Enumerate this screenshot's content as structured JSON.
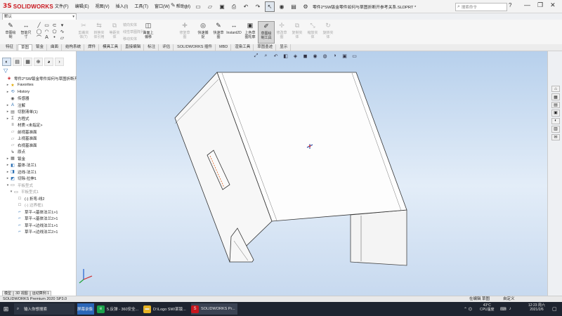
{
  "window": {
    "title": "零件2*SW钣金零件如何与草图折断开参考关系.SLDPRT *",
    "controls": [
      "—",
      "❐",
      "✕"
    ]
  },
  "app": {
    "brand_prefix": "3S",
    "brand": "SOLIDWORKS"
  },
  "menu": [
    "文件(F)",
    "编辑(E)",
    "视图(V)",
    "插入(I)",
    "工具(T)",
    "窗口(W)",
    "帮助(H)"
  ],
  "search": {
    "placeholder": "搜索命令"
  },
  "doc_selector": {
    "value": "默认"
  },
  "ribbon": {
    "sketch_buttons": [
      {
        "label": "草图绘\n制",
        "icon": "sketch-icon"
      },
      {
        "label": "智能尺\n寸",
        "icon": "smart-dimension-icon"
      }
    ],
    "buttons": [
      {
        "label": "剪裁实\n体(T)",
        "icon": "trim-icon",
        "enabled": false
      },
      {
        "label": "转换实\n体引用",
        "icon": "convert-icon",
        "enabled": false
      },
      {
        "label": "等距实\n体",
        "icon": "offset-icon",
        "enabled": false
      },
      {
        "label": "曲面上\n偏移",
        "icon": "surface-offset-icon",
        "enabled": true
      },
      {
        "label": "线性草\n图阵列",
        "icon": "linear-pattern-icon",
        "enabled": false
      },
      {
        "label": "显示/删\n除几何关系",
        "icon": "relations-icon",
        "enabled": false
      },
      {
        "label": "修复草\n图",
        "icon": "repair-icon",
        "enabled": false
      },
      {
        "label": "快速捕\n捉",
        "icon": "quick-snap-icon",
        "enabled": true
      },
      {
        "label": "快速草\n图",
        "icon": "quick-sketch-icon",
        "enabled": true
      },
      {
        "label": "Instant2D",
        "icon": "instant2d-icon",
        "enabled": true
      },
      {
        "label": "上色草\n图轮廓",
        "icon": "shaded-sketch-icon",
        "enabled": true
      },
      {
        "label": "草图绘\n制工具",
        "icon": "sketch-tools-icon",
        "enabled": true
      },
      {
        "label": "修改草\n图",
        "icon": "modify-sketch-icon",
        "enabled": false
      },
      {
        "label": "复制实\n体",
        "icon": "copy-entities-icon",
        "enabled": false
      },
      {
        "label": "缩放实\n体",
        "icon": "scale-icon",
        "enabled": false
      },
      {
        "label": "旋转实\n体",
        "icon": "rotate-icon",
        "enabled": false
      }
    ],
    "small_labels": [
      "镜向实体",
      "线性草图阵列",
      "移动实体"
    ]
  },
  "command_tabs": [
    "特征",
    "草图",
    "钣金",
    "曲面",
    "结构系统",
    "焊件",
    "模具工具",
    "直接编辑",
    "标注",
    "评估",
    "SOLIDWORKS 插件",
    "MBD",
    "渲染工具",
    "草图墨迹",
    "显示"
  ],
  "feature_tree": [
    {
      "label": "零件2*SW钣金零件如何与草图折断开参考",
      "icon": "part-icon",
      "indent": 0,
      "expander": "",
      "dim": false
    },
    {
      "label": "Favorites",
      "icon": "star-icon",
      "indent": 1,
      "expander": "▸",
      "dim": false
    },
    {
      "label": "History",
      "icon": "history-icon",
      "indent": 1,
      "expander": "▸",
      "dim": false
    },
    {
      "label": "传感器",
      "icon": "sensor-icon",
      "indent": 1,
      "expander": "",
      "dim": false
    },
    {
      "label": "注解",
      "icon": "annotation-icon",
      "indent": 1,
      "expander": "▸",
      "dim": false
    },
    {
      "label": "切割清单(1)",
      "icon": "cutlist-icon",
      "indent": 1,
      "expander": "▸",
      "dim": false
    },
    {
      "label": "方程式",
      "icon": "equation-icon",
      "indent": 1,
      "expander": "▸",
      "dim": false
    },
    {
      "label": "材质 <未指定>",
      "icon": "material-icon",
      "indent": 1,
      "expander": "",
      "dim": false
    },
    {
      "label": "前视基准面",
      "icon": "plane-icon",
      "indent": 1,
      "expander": "",
      "dim": false
    },
    {
      "label": "上视基准面",
      "icon": "plane-icon",
      "indent": 1,
      "expander": "",
      "dim": false
    },
    {
      "label": "右视基准面",
      "icon": "plane-icon",
      "indent": 1,
      "expander": "",
      "dim": false
    },
    {
      "label": "原点",
      "icon": "origin-icon",
      "indent": 1,
      "expander": "",
      "dim": false
    },
    {
      "label": "钣金",
      "icon": "sheetmetal-icon",
      "indent": 1,
      "expander": "▸",
      "dim": false
    },
    {
      "label": "基体-法兰1",
      "icon": "flange-icon",
      "indent": 1,
      "expander": "▸",
      "dim": false
    },
    {
      "label": "边线-法兰1",
      "icon": "edge-flange-icon",
      "indent": 1,
      "expander": "▸",
      "dim": false
    },
    {
      "label": "切除-拉伸1",
      "icon": "cut-icon",
      "indent": 1,
      "expander": "▸",
      "dim": false
    },
    {
      "label": "平板型式",
      "icon": "flat-pattern-icon",
      "indent": 1,
      "expander": "▾",
      "dim": true
    },
    {
      "label": "平板型式1",
      "icon": "flat-pattern-icon",
      "indent": 2,
      "expander": "▾",
      "dim": true
    },
    {
      "label": "(-) 折弯-线2",
      "icon": "sketch-icon",
      "indent": 3,
      "expander": "",
      "dim": false
    },
    {
      "label": "(-) 边界框1",
      "icon": "sketch-icon",
      "indent": 3,
      "expander": "",
      "dim": true
    },
    {
      "label": "草平-<基体法兰1>1",
      "icon": "bend-icon",
      "indent": 3,
      "expander": "",
      "dim": false
    },
    {
      "label": "草平-<基体法兰2>1",
      "icon": "bend-icon",
      "indent": 3,
      "expander": "",
      "dim": false
    },
    {
      "label": "草平-<边线法兰1>1",
      "icon": "bend-icon",
      "indent": 3,
      "expander": "",
      "dim": false
    },
    {
      "label": "草平-<边线法兰2>1",
      "icon": "bend-icon",
      "indent": 3,
      "expander": "",
      "dim": false
    }
  ],
  "panel_bottom_tabs": [
    "模型",
    "3D 视图",
    "运动算例 1"
  ],
  "status_bar": {
    "left": "SOLIDWORKS Premium 2020 SP3.0",
    "right_1": "在编辑 草图",
    "right_2": "自定义"
  },
  "taskbar": {
    "items": [
      {
        "label": "输入你想搜索",
        "icon": "search-icon"
      },
      {
        "label": "屏幕录像",
        "icon": "record-icon"
      },
      {
        "label": "5.反弹 - 360安全...",
        "icon": "browser-icon"
      },
      {
        "label": "D:\\Logo SW\\某钣...",
        "icon": "folder-icon"
      },
      {
        "label": "SOLIDWORKS Pr...",
        "icon": "solidworks-icon"
      }
    ],
    "temperature": "43°C",
    "cpu_label": "CPU温度",
    "time": "12:23 周六",
    "date": "2021/2/6"
  }
}
